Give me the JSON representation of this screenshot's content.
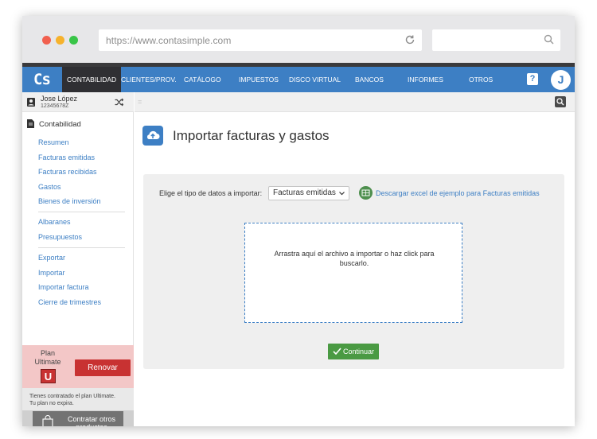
{
  "browser": {
    "url": "https://www.contasimple.com",
    "search_placeholder": ""
  },
  "nav": {
    "logo": "Cs",
    "items": [
      {
        "label": "CONTABILIDAD",
        "active": true
      },
      {
        "label": "CLIENTES/PROV."
      },
      {
        "label": "CATÁLOGO"
      },
      {
        "label": "IMPUESTOS"
      },
      {
        "label": "DISCO VIRTUAL"
      },
      {
        "label": "BANCOS"
      },
      {
        "label": "INFORMES"
      },
      {
        "label": "OTROS"
      }
    ],
    "help": "?",
    "avatar_initial": "J"
  },
  "user": {
    "name": "Jose López",
    "id": "12345678Z"
  },
  "sidebar": {
    "section_title": "Contabilidad",
    "group1": [
      "Resumen",
      "Facturas emitidas",
      "Facturas recibidas",
      "Gastos",
      "Bienes de inversión"
    ],
    "group2": [
      "Albaranes",
      "Presupuestos"
    ],
    "group3": [
      "Exportar",
      "Importar",
      "Importar factura",
      "Cierre de trimestres"
    ]
  },
  "plan": {
    "label_line1": "Plan",
    "label_line2": "Ultimate",
    "badge": "U",
    "renew": "Renovar",
    "note_line1": "Tienes contratado el plan Ultimate.",
    "note_line2": "Tu plan no expira.",
    "contract_line1": "Contratar otros",
    "contract_line2": "productos"
  },
  "strip": {
    "menu_glyph": "="
  },
  "main": {
    "title": "Importar facturas y gastos",
    "type_label": "Elige el tipo de datos a importar:",
    "type_value": "Facturas emitidas",
    "excel_link": "Descargar excel de ejemplo para Facturas emitidas",
    "drop_text": "Arrastra aquí el archivo a importar o haz click para buscarlo.",
    "continue": "Continuar"
  },
  "colors": {
    "brand_blue": "#3d7fc4",
    "nav_active": "#2f2f33",
    "renew_red": "#c83232",
    "continue_green": "#4a9a43"
  }
}
